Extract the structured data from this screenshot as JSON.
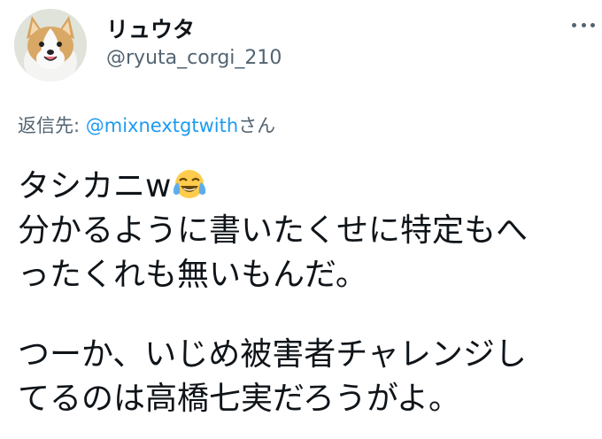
{
  "user": {
    "display_name": "リュウタ",
    "handle": "@ryuta_corgi_210"
  },
  "reply": {
    "prefix": "返信先: ",
    "mention": "@mixnextgtwith",
    "suffix": "さん"
  },
  "tweet": {
    "line1_text": "タシカニw",
    "line1_emoji": "😂",
    "line2": "分かるように書いたくせに特定もへ",
    "line3": "ったくれも無いもんだ。",
    "line4": "つーか、いじめ被害者チャレンジし",
    "line5": "てるのは高橋七実だろうがよ。"
  },
  "colors": {
    "text": "#0f1419",
    "secondary": "#536471",
    "accent": "#1d9bf0"
  },
  "icons": {
    "more": "more-options-icon",
    "emoji": "face-with-tears-of-joy-icon"
  }
}
